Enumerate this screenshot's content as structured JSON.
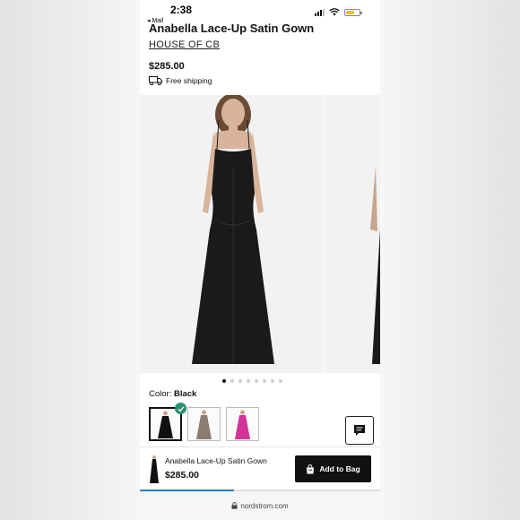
{
  "status_bar": {
    "time": "2:38",
    "back_label": "◂ Mail"
  },
  "product": {
    "title": "Anabella Lace-Up Satin Gown",
    "brand": "HOUSE OF CB",
    "price": "$285.00",
    "shipping": "Free shipping"
  },
  "gallery": {
    "dot_count": 8,
    "active_index": 0
  },
  "color": {
    "label": "Color:",
    "selected": "Black",
    "swatch_colors": [
      "#111111",
      "#8a7d70",
      "#d6339a"
    ]
  },
  "sticky_bar": {
    "name": "Anabella Lace-Up Satin Gown",
    "price": "$285.00",
    "add_to_bag": "Add to Bag"
  },
  "browser": {
    "url": "nordstrom.com",
    "load_progress": 0.39
  },
  "colors": {
    "accent_green": "#2c8f72",
    "progress_blue": "#2a7fc1",
    "battery_yellow": "#f4c20d"
  }
}
